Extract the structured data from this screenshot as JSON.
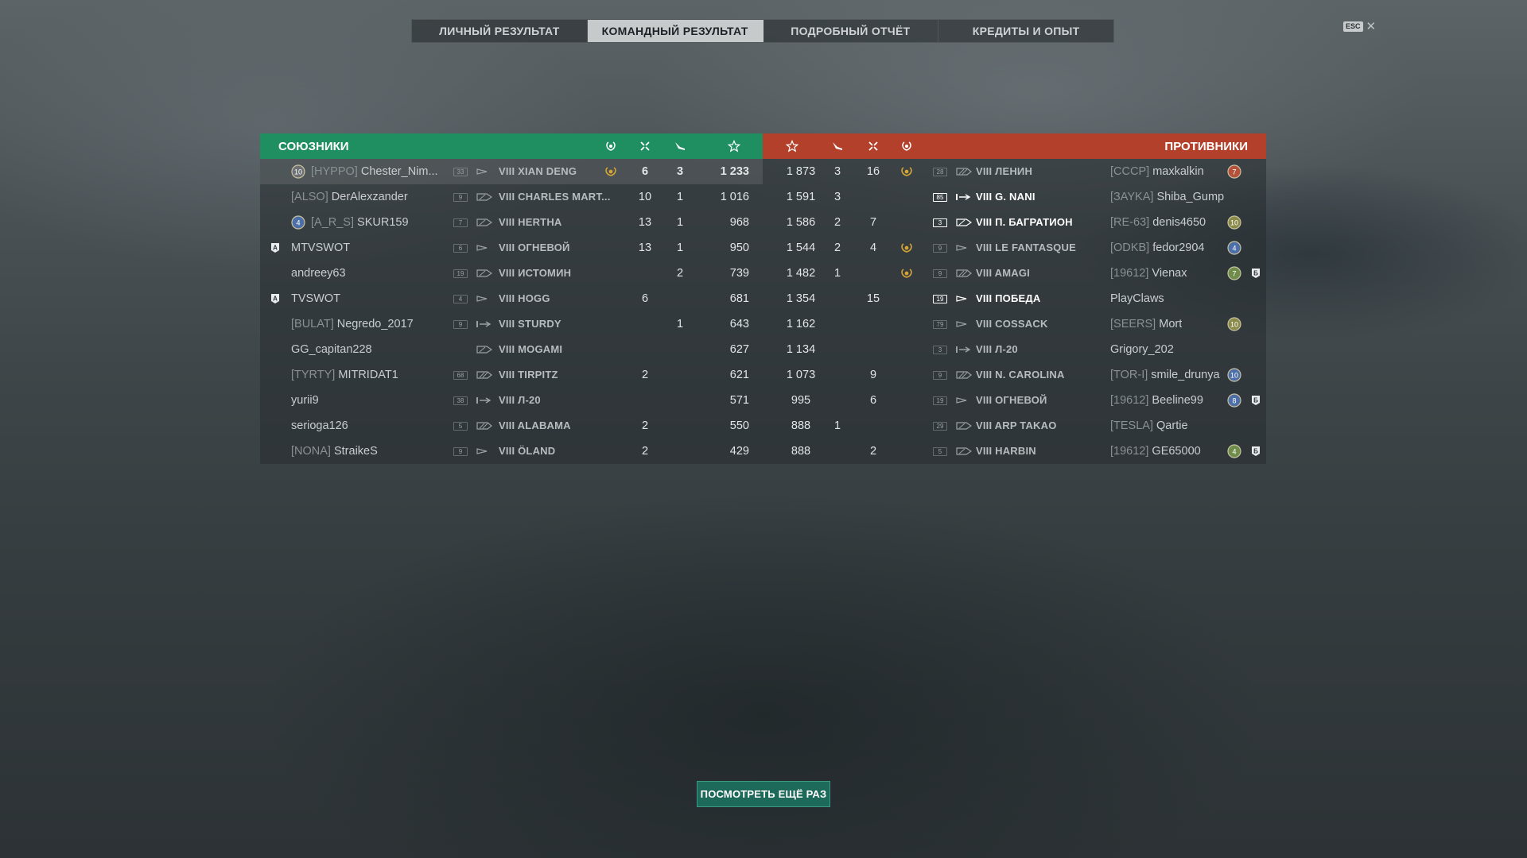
{
  "tabs": [
    {
      "label": "ЛИЧНЫЙ РЕЗУЛЬТАТ",
      "active": false
    },
    {
      "label": "КОМАНДНЫЙ РЕЗУЛЬТАТ",
      "active": true
    },
    {
      "label": "ПОДРОБНЫЙ ОТЧЁТ",
      "active": false
    },
    {
      "label": "КРЕДИТЫ И ОПЫТ",
      "active": false
    }
  ],
  "esc": {
    "key": "ESC",
    "close": "✕"
  },
  "allies_header": "СОЮЗНИКИ",
  "enemies_header": "ПРОТИВНИКИ",
  "header_icons": [
    "laurel-icon",
    "frags-icon",
    "planes-icon",
    "star-icon"
  ],
  "colors": {
    "ally": "#1f8f62",
    "enemy": "#b3402b",
    "button": "#1d6a5a"
  },
  "allies": [
    {
      "rank": "10",
      "clan": "[HYPPO]",
      "name": "Chester_Nim...",
      "division": "",
      "level": "33",
      "tier": "VIII",
      "ship": "XIAN DENG",
      "ship_class": "destroyer",
      "laurel": true,
      "frags": "6",
      "planes": "3",
      "exp": "1 233",
      "highlight": true
    },
    {
      "rank": "",
      "clan": "[ALSO]",
      "name": "DerAlexzander",
      "division": "",
      "level": "9",
      "tier": "VIII",
      "ship": "CHARLES MART...",
      "ship_class": "cruiser",
      "laurel": false,
      "frags": "10",
      "planes": "1",
      "exp": "1 016",
      "highlight": false
    },
    {
      "rank": "4",
      "clan": "[A_R_S]",
      "name": "SKUR159",
      "division": "",
      "level": "7",
      "tier": "VIII",
      "ship": "HERTHA",
      "ship_class": "cruiser",
      "laurel": false,
      "frags": "13",
      "planes": "1",
      "exp": "968",
      "highlight": false
    },
    {
      "rank": "",
      "clan": "",
      "name": "MTVSWOT",
      "division": "A",
      "level": "6",
      "tier": "VIII",
      "ship": "ОГНЕВОЙ",
      "ship_class": "destroyer",
      "laurel": false,
      "frags": "13",
      "planes": "1",
      "exp": "950",
      "highlight": false
    },
    {
      "rank": "",
      "clan": "",
      "name": "andreey63",
      "division": "",
      "level": "19",
      "tier": "VIII",
      "ship": "ИСТОМИН",
      "ship_class": "cruiser",
      "laurel": false,
      "frags": "",
      "planes": "2",
      "exp": "739",
      "highlight": false
    },
    {
      "rank": "",
      "clan": "",
      "name": "TVSWOT",
      "division": "A",
      "level": "4",
      "tier": "VIII",
      "ship": "HOGG",
      "ship_class": "destroyer",
      "laurel": false,
      "frags": "6",
      "planes": "",
      "exp": "681",
      "highlight": false
    },
    {
      "rank": "",
      "clan": "[BULAT]",
      "name": "Negredo_2017",
      "division": "",
      "level": "9",
      "tier": "VIII",
      "ship": "STURDY",
      "ship_class": "submarine",
      "laurel": false,
      "frags": "",
      "planes": "1",
      "exp": "643",
      "highlight": false
    },
    {
      "rank": "",
      "clan": "",
      "name": "GG_capitan228",
      "division": "",
      "level": "",
      "tier": "VIII",
      "ship": "MOGAMI",
      "ship_class": "cruiser",
      "laurel": false,
      "frags": "",
      "planes": "",
      "exp": "627",
      "highlight": false
    },
    {
      "rank": "",
      "clan": "[TYRTY]",
      "name": "MITRIDAT1",
      "division": "",
      "level": "68",
      "tier": "VIII",
      "ship": "TIRPITZ",
      "ship_class": "battleship",
      "laurel": false,
      "frags": "2",
      "planes": "",
      "exp": "621",
      "highlight": false
    },
    {
      "rank": "",
      "clan": "",
      "name": "yurii9",
      "division": "",
      "level": "38",
      "tier": "VIII",
      "ship": "Л-20",
      "ship_class": "submarine",
      "laurel": false,
      "frags": "",
      "planes": "",
      "exp": "571",
      "highlight": false
    },
    {
      "rank": "",
      "clan": "",
      "name": "serioga126",
      "division": "",
      "level": "5",
      "tier": "VIII",
      "ship": "ALABAMA",
      "ship_class": "battleship",
      "laurel": false,
      "frags": "2",
      "planes": "",
      "exp": "550",
      "highlight": false
    },
    {
      "rank": "",
      "clan": "[NONA]",
      "name": "StraikeS",
      "division": "",
      "level": "9",
      "tier": "VIII",
      "ship": "ÖLAND",
      "ship_class": "destroyer",
      "laurel": false,
      "frags": "2",
      "planes": "",
      "exp": "429",
      "highlight": false
    }
  ],
  "enemies": [
    {
      "exp": "1 873",
      "planes": "3",
      "frags": "16",
      "laurel": true,
      "level": "28",
      "tier": "VIII",
      "ship": "ЛЕНИН",
      "ship_class": "battleship",
      "bright": false,
      "clan": "[СССР]",
      "name": "maxkalkin",
      "rank": "7",
      "rank_color": "red",
      "division": ""
    },
    {
      "exp": "1 591",
      "planes": "3",
      "frags": "",
      "laurel": false,
      "level": "85",
      "tier": "VIII",
      "ship": "G. NANI",
      "ship_class": "submarine",
      "bright": true,
      "clan": "[ЗAYKA]",
      "name": "Shiba_Gump",
      "rank": "",
      "rank_color": "",
      "division": ""
    },
    {
      "exp": "1 586",
      "planes": "2",
      "frags": "7",
      "laurel": false,
      "level": "3",
      "tier": "VIII",
      "ship": "П. БАГРАТИОН",
      "ship_class": "cruiser",
      "bright": true,
      "clan": "[RE-63]",
      "name": "denis4650",
      "rank": "10",
      "rank_color": "olive",
      "division": ""
    },
    {
      "exp": "1 544",
      "planes": "2",
      "frags": "4",
      "laurel": true,
      "level": "9",
      "tier": "VIII",
      "ship": "LE FANTASQUE",
      "ship_class": "destroyer",
      "bright": false,
      "clan": "[ODKB]",
      "name": "fedor2904",
      "rank": "4",
      "rank_color": "blue",
      "division": ""
    },
    {
      "exp": "1 482",
      "planes": "1",
      "frags": "",
      "laurel": true,
      "level": "9",
      "tier": "VIII",
      "ship": "AMAGI",
      "ship_class": "battleship",
      "bright": false,
      "clan": "[19612]",
      "name": "Vienax",
      "rank": "7",
      "rank_color": "green",
      "division": "Б"
    },
    {
      "exp": "1 354",
      "planes": "",
      "frags": "15",
      "laurel": false,
      "level": "19",
      "tier": "VIII",
      "ship": "ПОБЕДА",
      "ship_class": "destroyer",
      "bright": true,
      "clan": "",
      "name": "PlayClaws",
      "rank": "",
      "rank_color": "",
      "division": ""
    },
    {
      "exp": "1 162",
      "planes": "",
      "frags": "",
      "laurel": false,
      "level": "79",
      "tier": "VIII",
      "ship": "COSSACK",
      "ship_class": "destroyer",
      "bright": false,
      "clan": "[SEERS]",
      "name": "Mort",
      "rank": "10",
      "rank_color": "olive",
      "division": ""
    },
    {
      "exp": "1 134",
      "planes": "",
      "frags": "",
      "laurel": false,
      "level": "3",
      "tier": "VIII",
      "ship": "Л-20",
      "ship_class": "submarine",
      "bright": false,
      "clan": "",
      "name": "Grigory_202",
      "rank": "",
      "rank_color": "",
      "division": ""
    },
    {
      "exp": "1 073",
      "planes": "",
      "frags": "9",
      "laurel": false,
      "level": "9",
      "tier": "VIII",
      "ship": "N. CAROLINA",
      "ship_class": "battleship",
      "bright": false,
      "clan": "[TOR-I]",
      "name": "smile_drunya",
      "rank": "10",
      "rank_color": "blue",
      "division": ""
    },
    {
      "exp": "995",
      "planes": "",
      "frags": "6",
      "laurel": false,
      "level": "19",
      "tier": "VIII",
      "ship": "ОГНЕВОЙ",
      "ship_class": "destroyer",
      "bright": false,
      "clan": "[19612]",
      "name": "Beeline99",
      "rank": "8",
      "rank_color": "blue",
      "division": "Б"
    },
    {
      "exp": "888",
      "planes": "1",
      "frags": "",
      "laurel": false,
      "level": "29",
      "tier": "VIII",
      "ship": "ARP TAKAO",
      "ship_class": "cruiser",
      "bright": false,
      "clan": "[TESLA]",
      "name": "Qartie",
      "rank": "",
      "rank_color": "",
      "division": ""
    },
    {
      "exp": "888",
      "planes": "",
      "frags": "2",
      "laurel": false,
      "level": "5",
      "tier": "VIII",
      "ship": "HARBIN",
      "ship_class": "cruiser",
      "bright": false,
      "clan": "[19612]",
      "name": "GE65000",
      "rank": "4",
      "rank_color": "green",
      "division": "Б"
    }
  ],
  "replay_button": "ПОСМОТРЕТЬ ЕЩЁ РАЗ"
}
